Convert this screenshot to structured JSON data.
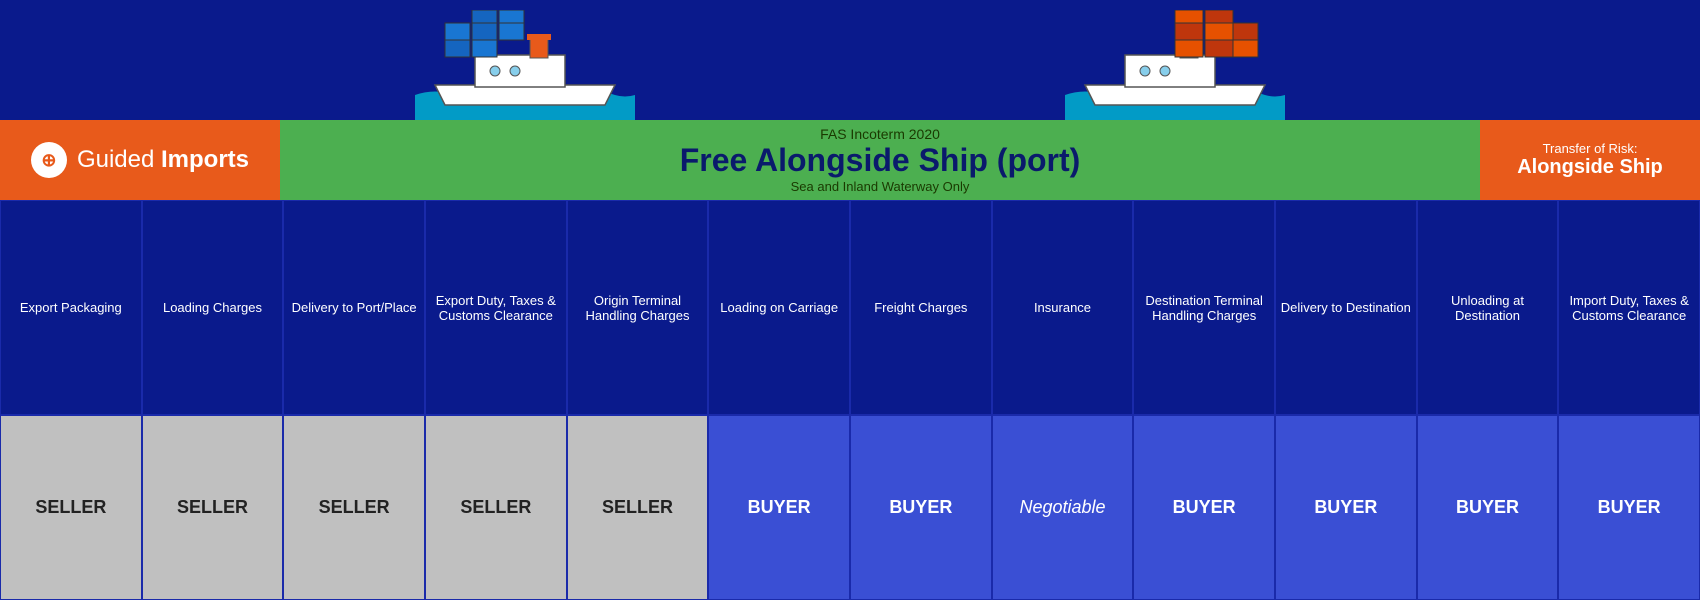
{
  "logo": {
    "icon": "⊕",
    "text_normal": "Guided",
    "text_bold": "Imports"
  },
  "header": {
    "incoterm_label": "FAS Incoterm 2020",
    "title": "Free Alongside Ship (port)",
    "subtitle": "Sea and Inland Waterway Only"
  },
  "risk": {
    "label": "Transfer of Risk:",
    "value": "Alongside Ship"
  },
  "columns": [
    {
      "id": "export-packaging",
      "label": "Export Packaging",
      "party": "SELLER",
      "party_type": "seller"
    },
    {
      "id": "loading-charges",
      "label": "Loading Charges",
      "party": "SELLER",
      "party_type": "seller"
    },
    {
      "id": "delivery-to-port",
      "label": "Delivery to Port/Place",
      "party": "SELLER",
      "party_type": "seller"
    },
    {
      "id": "export-duty",
      "label": "Export Duty, Taxes & Customs Clearance",
      "party": "SELLER",
      "party_type": "seller"
    },
    {
      "id": "origin-terminal",
      "label": "Origin Terminal Handling Charges",
      "party": "SELLER",
      "party_type": "seller"
    },
    {
      "id": "loading-on-carriage",
      "label": "Loading on Carriage",
      "party": "BUYER",
      "party_type": "buyer"
    },
    {
      "id": "freight-charges",
      "label": "Freight Charges",
      "party": "BUYER",
      "party_type": "buyer"
    },
    {
      "id": "insurance",
      "label": "Insurance",
      "party": "Negotiable",
      "party_type": "negotiable"
    },
    {
      "id": "destination-terminal",
      "label": "Destination Terminal Handling Charges",
      "party": "BUYER",
      "party_type": "buyer"
    },
    {
      "id": "delivery-to-destination",
      "label": "Delivery to Destination",
      "party": "BUYER",
      "party_type": "buyer"
    },
    {
      "id": "unloading-at-destination",
      "label": "Unloading at Destination",
      "party": "BUYER",
      "party_type": "buyer"
    },
    {
      "id": "import-duty",
      "label": "Import Duty, Taxes & Customs Clearance",
      "party": "BUYER",
      "party_type": "buyer"
    }
  ]
}
